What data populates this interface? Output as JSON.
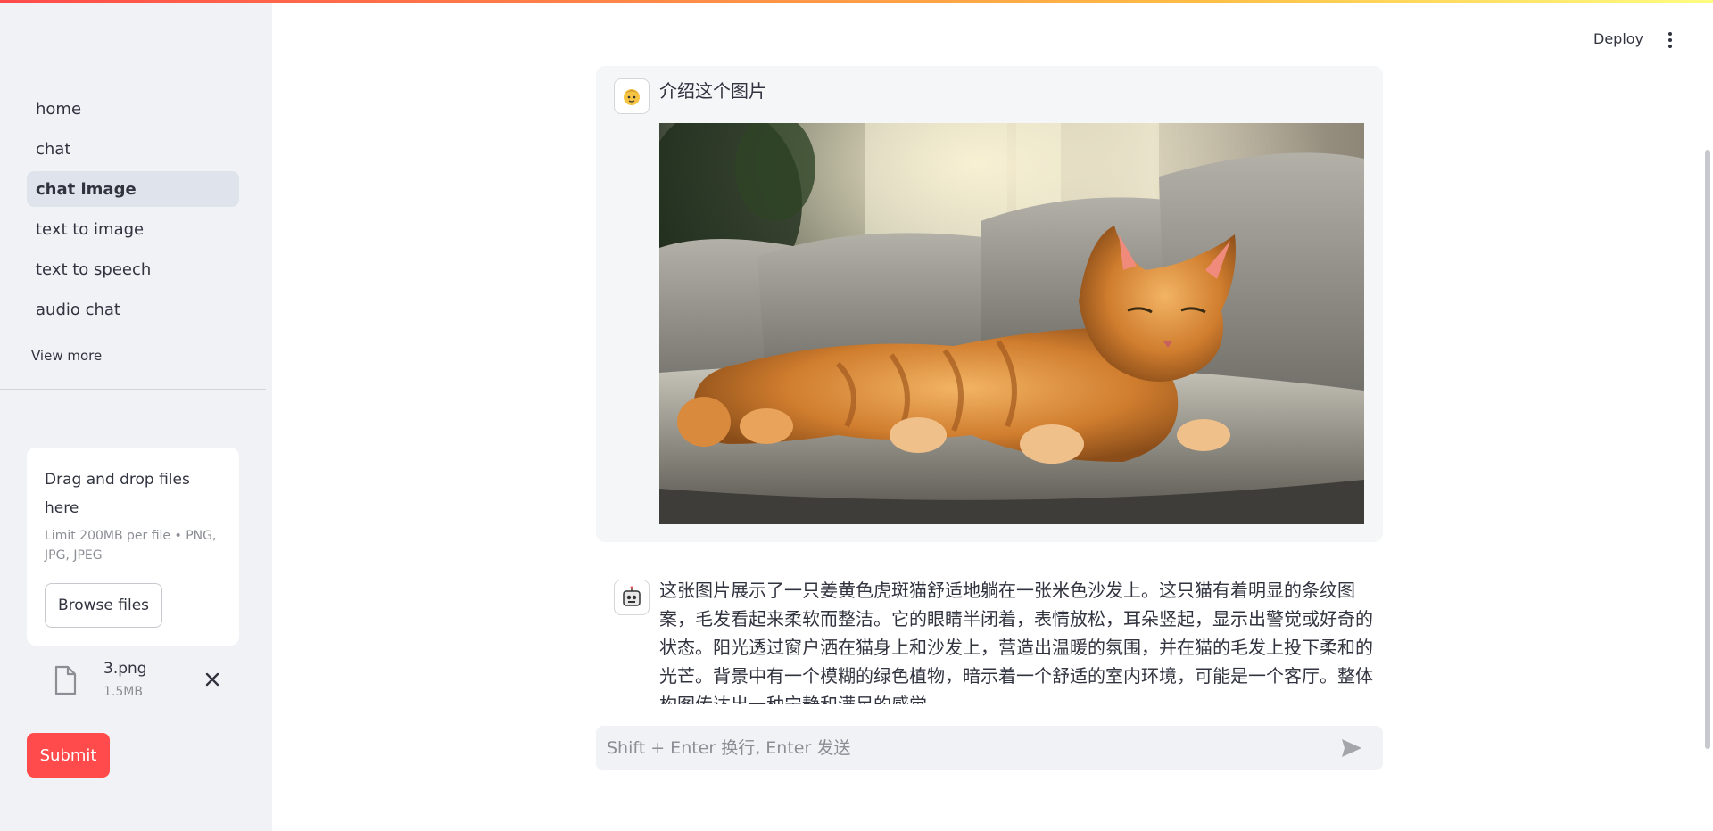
{
  "header": {
    "deploy_label": "Deploy",
    "menu_icon": "kebab-menu-icon"
  },
  "sidebar": {
    "nav_items": [
      {
        "label": "home",
        "active": false
      },
      {
        "label": "chat",
        "active": false
      },
      {
        "label": "chat image",
        "active": true
      },
      {
        "label": "text to image",
        "active": false
      },
      {
        "label": "text to speech",
        "active": false
      },
      {
        "label": "audio chat",
        "active": false
      }
    ],
    "view_more": "View more",
    "uploader": {
      "title": "Drag and drop files here",
      "limit": "Limit 200MB per file • PNG, JPG, JPEG",
      "browse_label": "Browse files"
    },
    "file": {
      "name": "3.png",
      "size": "1.5MB"
    },
    "submit_label": "Submit"
  },
  "chat": {
    "user_message": "介绍这个图片",
    "bot_message": "这张图片展示了一只姜黄色虎斑猫舒适地躺在一张米色沙发上。这只猫有着明显的条纹图案，毛发看起来柔软而整洁。它的眼睛半闭着，表情放松，耳朵竖起，显示出警觉或好奇的状态。阳光透过窗户洒在猫身上和沙发上，营造出温暖的氛围，并在猫的毛发上投下柔和的光芒。背景中有一个模糊的绿色植物，暗示着一个舒适的室内环境，可能是一个客厅。整体构图传达出一种宁静和满足的感觉。"
  },
  "input": {
    "placeholder": "Shift + Enter 换行, Enter 发送"
  },
  "colors": {
    "accent": "#ff4b4b",
    "sidebar_bg": "#f0f2f6",
    "text": "#31333f"
  }
}
